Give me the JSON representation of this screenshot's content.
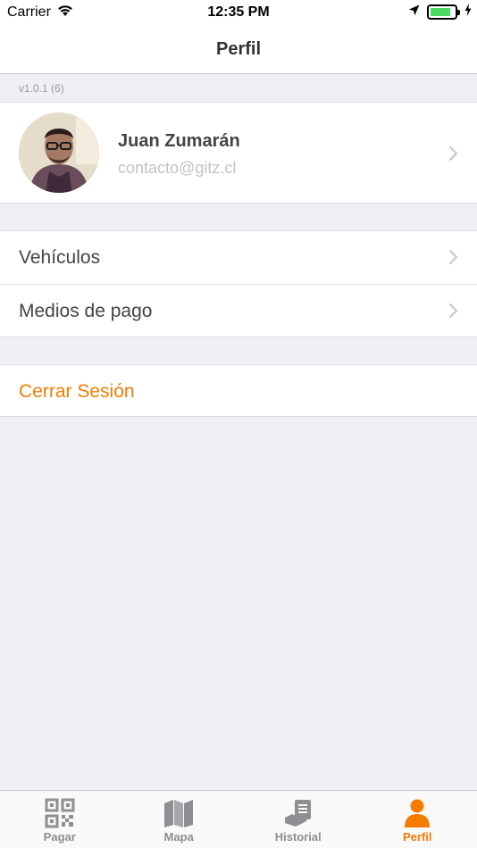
{
  "status_bar": {
    "carrier": "Carrier",
    "time": "12:35 PM",
    "battery_level": 0.85
  },
  "nav": {
    "title": "Perfil"
  },
  "version": "v1.0.1 (6)",
  "profile": {
    "name": "Juan Zumarán",
    "email": "contacto@gitz.cl"
  },
  "menu": {
    "vehicles": "Vehículos",
    "payment": "Medios de pago"
  },
  "logout": "Cerrar Sesión",
  "tabs": [
    {
      "label": "Pagar",
      "icon": "qr-code-icon"
    },
    {
      "label": "Mapa",
      "icon": "map-icon"
    },
    {
      "label": "Historial",
      "icon": "history-icon"
    },
    {
      "label": "Perfil",
      "icon": "profile-icon",
      "active": true
    }
  ],
  "colors": {
    "accent": "#f57c00",
    "background": "#efeff4",
    "inactive": "#8e8e93",
    "battery": "#4cd964"
  }
}
